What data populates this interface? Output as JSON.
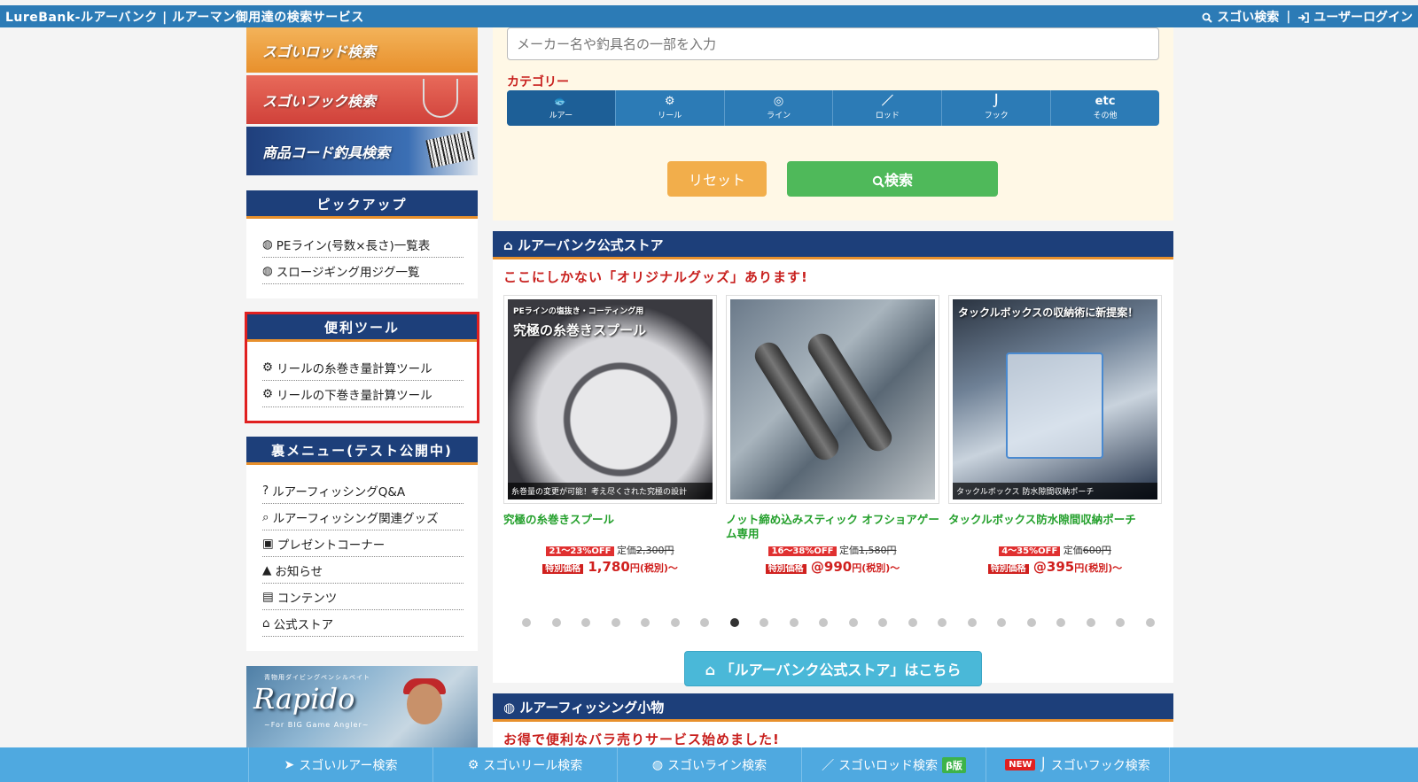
{
  "topbar": {
    "title": "LureBank-ルアーバンク | ルアーマン御用達の検索サービス",
    "search_link": "スゴい検索",
    "login_link": "ユーザーログイン",
    "separator": "|"
  },
  "sidebar": {
    "banners": [
      {
        "label": "スゴいロッド検索"
      },
      {
        "label": "スゴいフック検索"
      },
      {
        "label": "商品コード釣具検索"
      }
    ],
    "pickup": {
      "title": "ピックアップ",
      "items": [
        {
          "label": "PEライン(号数×長さ)一覧表",
          "icon": "line-spool-icon"
        },
        {
          "label": "スロージギング用ジグ一覧",
          "icon": "line-spool-icon"
        }
      ]
    },
    "tools": {
      "title": "便利ツール",
      "items": [
        {
          "label": "リールの糸巻き量計算ツール",
          "icon": "reel-icon"
        },
        {
          "label": "リールの下巻き量計算ツール",
          "icon": "reel-icon"
        }
      ]
    },
    "secret": {
      "title": "裏メニュー(テスト公開中)",
      "items": [
        {
          "label": "ルアーフィッシングQ&A",
          "icon": "question-icon"
        },
        {
          "label": "ルアーフィッシング関連グッズ",
          "icon": "search-icon"
        },
        {
          "label": "プレゼントコーナー",
          "icon": "gift-icon"
        },
        {
          "label": "お知らせ",
          "icon": "bell-icon"
        },
        {
          "label": "コンテンツ",
          "icon": "book-icon"
        },
        {
          "label": "公式ストア",
          "icon": "basket-icon"
        }
      ]
    },
    "promo": {
      "logo": "Rapido",
      "tagline": "~For BIG Game Angler~",
      "top": "青物用ダイビングペンシルベイト"
    }
  },
  "search": {
    "placeholder": "メーカー名や釣具名の一部を入力",
    "category_label": "カテゴリー",
    "categories": [
      {
        "label": "ルアー",
        "glyph": "🐟",
        "active": true
      },
      {
        "label": "リール",
        "glyph": "⚙",
        "active": false
      },
      {
        "label": "ライン",
        "glyph": "◎",
        "active": false
      },
      {
        "label": "ロッド",
        "glyph": "／",
        "active": false
      },
      {
        "label": "フック",
        "glyph": "⌡",
        "active": false
      },
      {
        "label": "その他",
        "glyph": "etc",
        "active": false
      }
    ],
    "reset_label": "リセット",
    "search_label": "検索"
  },
  "store": {
    "title": "ルアーバンク公式ストア",
    "subtitle": "ここにしかない「オリジナルグッズ」あります!",
    "products": [
      {
        "name": "究極の糸巻きスプール",
        "img_top": "PEラインの塩抜き・コーティング用",
        "img_title": "究極の糸巻きスプール",
        "img_bottom": "糸巻量の変更が可能！考え尽くされた究極の設計",
        "discount": "21〜23%OFF",
        "list_label": "定価",
        "list_price": "2,300円",
        "special": "特別価格",
        "price": "1,780",
        "price_suffix": "円",
        "tax": "(税別)〜"
      },
      {
        "name": "ノット締め込みスティック オフショアゲーム専用",
        "img_top": "",
        "img_title": "",
        "img_bottom": "",
        "discount": "16〜38%OFF",
        "list_label": "定価",
        "list_price": "1,580円",
        "special": "特別価格",
        "price": "@990",
        "price_suffix": "円",
        "tax": "(税別)〜"
      },
      {
        "name": "タックルボックス防水隙間収納ポーチ",
        "img_top": "タックルボックスの収納術に新提案！",
        "img_title": "",
        "img_bottom": "タックルボックス 防水隙間収納ポーチ",
        "discount": "4〜35%OFF",
        "list_label": "定価",
        "list_price": "600円",
        "special": "特別価格",
        "price": "@395",
        "price_suffix": "円",
        "tax": "(税別)〜"
      }
    ],
    "carousel": {
      "count": 22,
      "active_index": 7
    },
    "button_label": "「ルアーバンク公式ストア」はこちら"
  },
  "small_goods": {
    "title": "ルアーフィッシング小物",
    "subtitle": "お得で便利なバラ売りサービス始めました!"
  },
  "bottom_nav": [
    {
      "label": "スゴいルアー検索",
      "icon": "lure-icon",
      "badge": "",
      "badge_left": ""
    },
    {
      "label": "スゴいリール検索",
      "icon": "reel-icon",
      "badge": "",
      "badge_left": ""
    },
    {
      "label": "スゴいライン検索",
      "icon": "line-spool-icon",
      "badge": "",
      "badge_left": ""
    },
    {
      "label": "スゴいロッド検索",
      "icon": "rod-icon",
      "badge": "β版",
      "badge_left": ""
    },
    {
      "label": "スゴいフック検索",
      "icon": "hook-icon",
      "badge": "",
      "badge_left": "NEW"
    }
  ],
  "colors": {
    "topbar": "#2c7bb6",
    "section_header": "#1d3f7a",
    "accent_orange": "#e8902c",
    "search_green": "#4fb95a",
    "reset_orange": "#f2ae4b",
    "store_button": "#4ab8d8",
    "bottom_bar": "#4fa9e0",
    "highlight_red": "#e02020"
  }
}
